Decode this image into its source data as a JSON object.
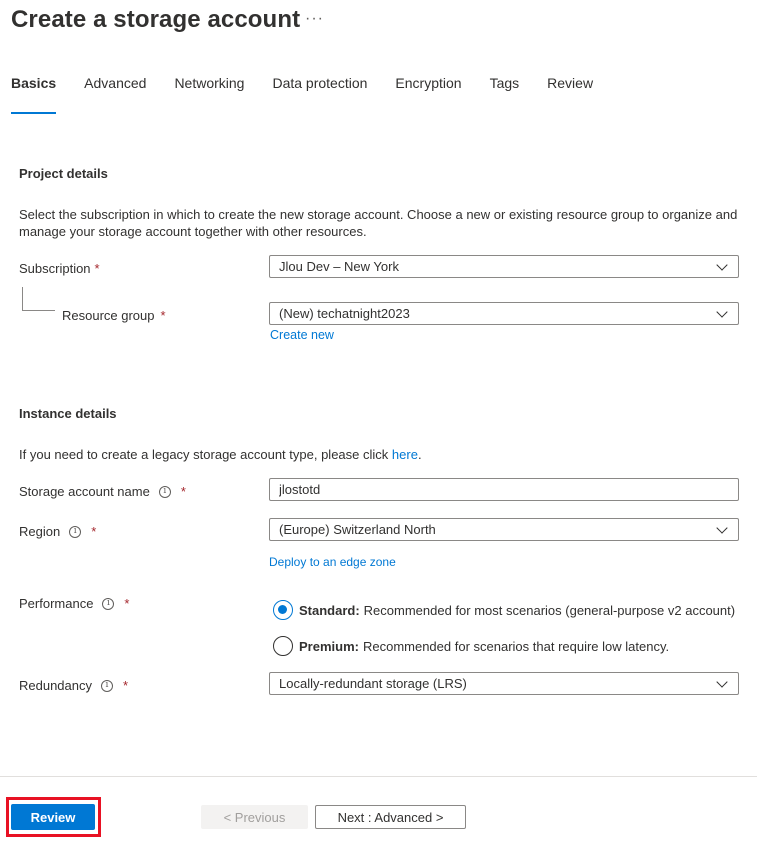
{
  "page": {
    "title": "Create a storage account",
    "more": "···"
  },
  "tabs": [
    {
      "label": "Basics",
      "active": true
    },
    {
      "label": "Advanced",
      "active": false
    },
    {
      "label": "Networking",
      "active": false
    },
    {
      "label": "Data protection",
      "active": false
    },
    {
      "label": "Encryption",
      "active": false
    },
    {
      "label": "Tags",
      "active": false
    },
    {
      "label": "Review",
      "active": false
    }
  ],
  "project": {
    "title": "Project details",
    "description": "Select the subscription in which to create the new storage account. Choose a new or existing resource group to organize and manage your storage account together with other resources.",
    "subscription_label": "Subscription",
    "subscription_value": "Jlou Dev – New York",
    "resource_group_label": "Resource group",
    "resource_group_value": "(New) techatnight2023",
    "create_new": "Create new"
  },
  "instance": {
    "title": "Instance details",
    "legacy_text": "If you need to create a legacy storage account type, please click",
    "legacy_link": "here",
    "legacy_end": ".",
    "name_label": "Storage account name",
    "name_value": "jlostotd",
    "region_label": "Region",
    "region_value": "(Europe) Switzerland North",
    "edge_zone_link": "Deploy to an edge zone",
    "performance_label": "Performance",
    "performance_options": [
      {
        "name": "Standard:",
        "desc": "Recommended for most scenarios (general-purpose v2 account)",
        "selected": true
      },
      {
        "name": "Premium:",
        "desc": "Recommended for scenarios that require low latency.",
        "selected": false
      }
    ],
    "redundancy_label": "Redundancy",
    "redundancy_value": "Locally-redundant storage (LRS)"
  },
  "required_mark": "*",
  "info_glyph": "i",
  "footer": {
    "review": "Review",
    "previous": "< Previous",
    "next": "Next : Advanced >"
  },
  "colors": {
    "accent": "#0078d4",
    "highlight": "#e81123",
    "required": "#a4262c"
  }
}
